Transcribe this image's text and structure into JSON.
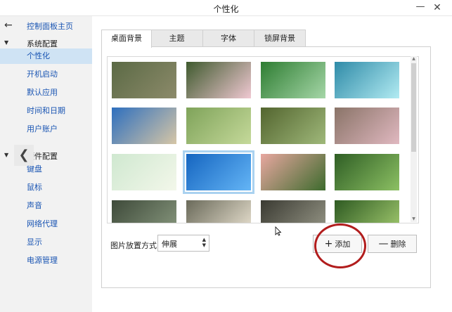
{
  "window": {
    "title": "个性化",
    "minimize_glyph": "—",
    "close_glyph": "✕"
  },
  "sidebar": {
    "back_glyph": "←",
    "home_link": "控制面板主页",
    "groups": [
      {
        "title": "系统配置",
        "items": [
          "个性化",
          "开机启动",
          "默认应用",
          "时间和日期",
          "用户账户"
        ]
      },
      {
        "title": "硬件配置",
        "items": [
          "键盘",
          "鼠标",
          "声音",
          "网络代理",
          "显示",
          "电源管理"
        ]
      }
    ],
    "active_item": "个性化"
  },
  "tabs": [
    "桌面背景",
    "主题",
    "字体",
    "锁屏背景"
  ],
  "active_tab": "桌面背景",
  "gallery": {
    "thumbnails": [
      {
        "name": "mossy-roof",
        "colors": [
          "#5b6a45",
          "#8c8a6a"
        ]
      },
      {
        "name": "pink-flowers",
        "colors": [
          "#3f5a2e",
          "#f0c8d2"
        ]
      },
      {
        "name": "green-grass-flower",
        "colors": [
          "#2e7d32",
          "#a5d6a7"
        ]
      },
      {
        "name": "tower-sky",
        "colors": [
          "#2f8ba8",
          "#b2ebf2"
        ]
      },
      {
        "name": "desert-sky",
        "colors": [
          "#2e6fbe",
          "#d6c6a6"
        ]
      },
      {
        "name": "green-meadow",
        "colors": [
          "#7fa35a",
          "#c5d99a"
        ]
      },
      {
        "name": "kingfisher-bird",
        "colors": [
          "#53652f",
          "#9fb87a"
        ]
      },
      {
        "name": "pink-petals",
        "colors": [
          "#8a7468",
          "#e0b8c0"
        ]
      },
      {
        "name": "pastel-plants",
        "colors": [
          "#cfe8d0",
          "#f3f7ea"
        ]
      },
      {
        "name": "blue-win7",
        "colors": [
          "#1565c0",
          "#64b5f6"
        ]
      },
      {
        "name": "sunset-trees",
        "colors": [
          "#e8a7a0",
          "#3d6b2d"
        ]
      },
      {
        "name": "green-moss",
        "colors": [
          "#2f5e25",
          "#8cc063"
        ]
      },
      {
        "name": "green-field-dark",
        "colors": [
          "#3e4a3a",
          "#8a9a80"
        ]
      },
      {
        "name": "white-rose",
        "colors": [
          "#6a6a5a",
          "#efe7d6"
        ]
      },
      {
        "name": "dark-forest",
        "colors": [
          "#3a3a32",
          "#9a9a8a"
        ]
      },
      {
        "name": "forest-path",
        "colors": [
          "#2e5a22",
          "#a7cf72"
        ]
      }
    ],
    "selected_index": 9
  },
  "placement": {
    "label": "图片放置方式:",
    "value": "伸展"
  },
  "buttons": {
    "add_label": "添加",
    "add_glyph": "+",
    "delete_label": "删除",
    "delete_glyph": "—"
  },
  "carousel": {
    "left_glyph": "❮",
    "right_glyph": "❯"
  },
  "colors": {
    "accent_link": "#1a55b3",
    "selection": "#cfe3f4",
    "annotation_circle": "#b21d1d"
  }
}
